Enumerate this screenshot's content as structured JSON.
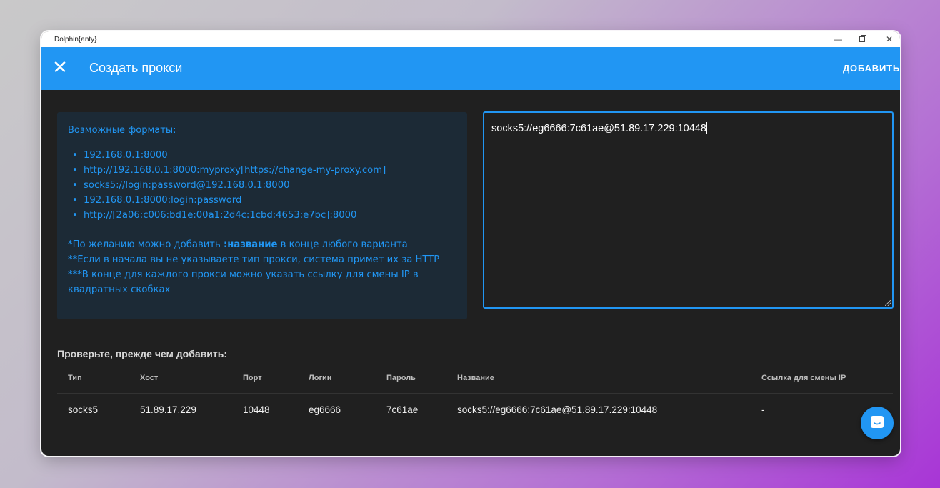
{
  "window": {
    "app_title": "Dolphin{anty}",
    "controls": {
      "minimize": "—",
      "close": "✕"
    }
  },
  "header": {
    "title": "Создать прокси",
    "add_button": "ДОБАВИТЬ"
  },
  "info": {
    "heading": "Возможные форматы:",
    "formats": [
      "192.168.0.1:8000",
      "http://192.168.0.1:8000:myproxy[https://change-my-proxy.com]",
      "socks5://login:password@192.168.0.1:8000",
      "192.168.0.1:8000:login:password",
      "http://[2a06:c006:bd1e:00a1:2d4c:1cbd:4653:e7bc]:8000"
    ],
    "note1_prefix": "*По желанию можно добавить ",
    "note1_bold": ":название",
    "note1_suffix": " в конце любого варианта",
    "note2": "**Если в начала вы не указываете тип прокси, система примет их за HTTP",
    "note3": "***В конце для каждого прокси можно указать ссылку для смены IP в квадратных скобках"
  },
  "proxy_input": {
    "value": "socks5://eg6666:7c61ae@51.89.17.229:10448"
  },
  "check": {
    "title": "Проверьте, прежде чем добавить:",
    "columns": [
      "Тип",
      "Хост",
      "Порт",
      "Логин",
      "Пароль",
      "Название",
      "Ссылка для смены IP"
    ],
    "rows": [
      [
        "socks5",
        "51.89.17.229",
        "10448",
        "eg6666",
        "7c61ae",
        "socks5://eg6666:7c61ae@51.89.17.229:10448",
        "-"
      ]
    ]
  },
  "colors": {
    "accent": "#2196f3",
    "background": "#202020",
    "info_panel": "#1c2a36"
  },
  "icons": {
    "close": "close-x-icon",
    "chat": "chat-bubble-icon"
  }
}
